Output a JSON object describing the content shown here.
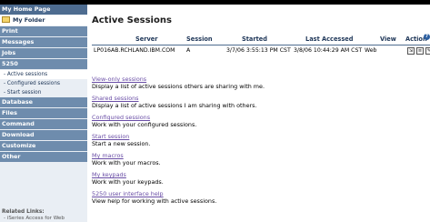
{
  "sidebar": {
    "items": [
      {
        "label": "My Home Page"
      },
      {
        "label": "My Folder"
      },
      {
        "label": "Print"
      },
      {
        "label": "Messages"
      },
      {
        "label": "Jobs"
      },
      {
        "label": "5250"
      },
      {
        "label": "- Active sessions"
      },
      {
        "label": "- Configured sessions"
      },
      {
        "label": "- Start session"
      },
      {
        "label": "Database"
      },
      {
        "label": "Files"
      },
      {
        "label": "Command"
      },
      {
        "label": "Download"
      },
      {
        "label": "Customize"
      },
      {
        "label": "Other"
      }
    ],
    "related_title": "Related Links:",
    "related_link": "- iSeries Access for Web"
  },
  "main": {
    "title": "Active Sessions",
    "table": {
      "headers": [
        "Server",
        "Session",
        "Started",
        "Last Accessed",
        "View",
        "Action"
      ],
      "rows": [
        {
          "server": "LP016AB.RCHLAND.IBM.COM",
          "session": "A",
          "started": "3/7/06 3:55:13 PM CST",
          "last_accessed": "3/8/06 10:44:29 AM CST",
          "view": "Web"
        }
      ],
      "help_glyph": "?",
      "action_glyphs": [
        "⇲",
        "≡",
        "✎",
        "↻"
      ]
    },
    "links": [
      {
        "label": "View-only sessions",
        "desc": "Display a list of active sessions others are sharing with me."
      },
      {
        "label": "Shared sessions",
        "desc": "Display a list of active sessions I am sharing with others."
      },
      {
        "label": "Configured sessions",
        "desc": "Work with your configured sessions."
      },
      {
        "label": "Start session",
        "desc": "Start a new session."
      },
      {
        "label": "My macros",
        "desc": "Work with your macros."
      },
      {
        "label": "My keypads",
        "desc": "Work with your keypads."
      },
      {
        "label": "5250 user interface help",
        "desc": "View help for working with active sessions."
      }
    ]
  },
  "colors": {
    "nav_bg": "#6e8cad",
    "nav_header_bg": "#4e6c90",
    "sidebar_bg": "#e9eef4",
    "link": "#6a4ea6",
    "header_text": "#1d3557"
  }
}
